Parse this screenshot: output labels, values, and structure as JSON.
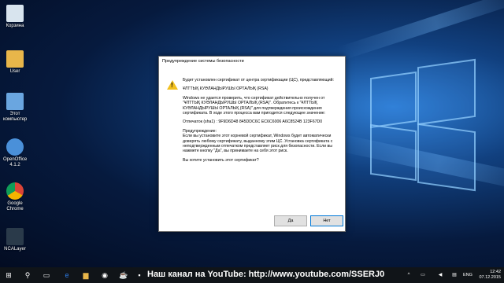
{
  "desktop": {
    "icons": [
      {
        "label": "Корзина",
        "color": "#d8e4ee"
      },
      {
        "label": "User",
        "color": "#e8b64a"
      },
      {
        "label": "Этот компьютер",
        "color": "#6aa6e0"
      },
      {
        "label": "OpenOffice 4.1.2",
        "color": "#4a90d9"
      },
      {
        "label": "Google Chrome",
        "color": "#db4437"
      },
      {
        "label": "NCALayer",
        "color": "#2a3a4a"
      }
    ]
  },
  "dialog": {
    "title": "Предупреждение системы безопасности",
    "intro": "Будет установлен сертификат от центра сертификации (ЦС), представляющий:",
    "issuer": "ҰЛТТЫҚ КУӘЛАНДЫРУШЫ ОРТАЛЫҚ (RSA)",
    "body1": "Windows не удается проверить, что сертификат действительно получен от \"ҰЛТТЫҚ КУӘЛАНДЫРУШЫ ОРТАЛЫҚ (RSA)\". Обратитесь к \"ҰЛТТЫҚ КУӘЛАНДЫРУШЫ ОРТАЛЫҚ (RSA)\" для подтверждения происхождения сертификата. В ходе этого процесса вам пригодится следующее значение:",
    "thumbprint": "Отпечаток (sha1) : 9F9D6D48 845DDC6C EC6C6006 A6C8524B 123F67D0",
    "warning_heading": "Предупреждение:",
    "warning_text": "Если вы установите этот корневой сертификат, Windows будет автоматически доверять любому сертификату, выданному этим ЦС. Установка сертификата с неподтвержденным отпечатком представляет риск для безопасности. Если вы нажмете кнопку \"Да\", вы принимаете на себя этот риск.",
    "question": "Вы хотите установить этот сертификат?",
    "yes_label": "Да",
    "no_label": "Нет"
  },
  "taskbar": {
    "banner": "Наш канал на YouTube: http://www.youtube.com/SSERJ0",
    "language": "ENG",
    "time": "12:42",
    "date": "07.12.2015"
  }
}
